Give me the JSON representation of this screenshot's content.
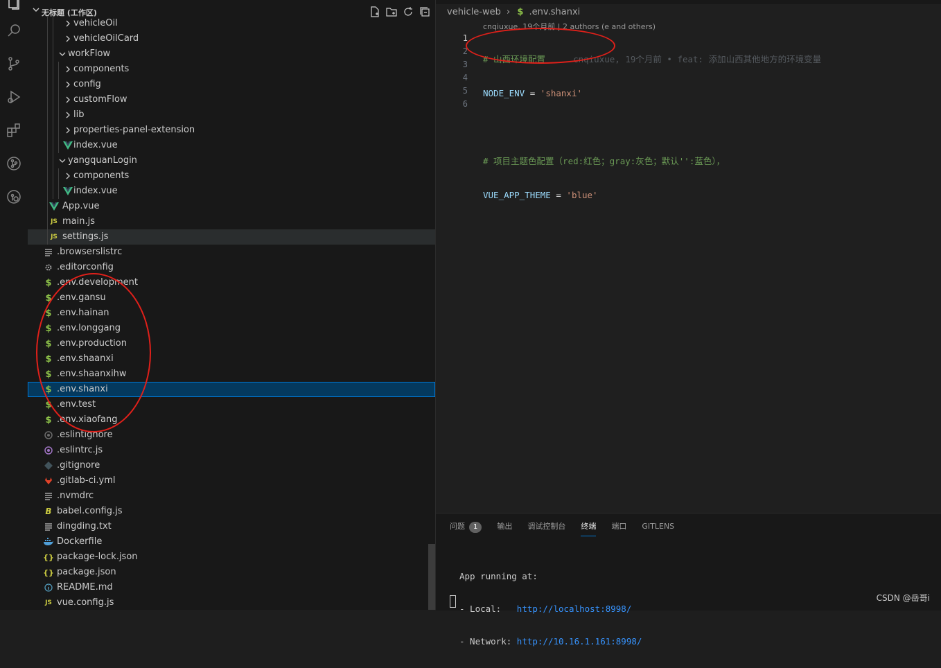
{
  "sidebar": {
    "title": "无标题 (工作区)",
    "items": [
      {
        "label": "vehicleOil",
        "type": "folder",
        "depth": 2,
        "icon": "chevron-right-icon"
      },
      {
        "label": "vehicleOilCard",
        "type": "folder",
        "depth": 2,
        "icon": "chevron-right-icon"
      },
      {
        "label": "workFlow",
        "type": "folder-open",
        "depth": 1,
        "icon": "chevron-down-icon"
      },
      {
        "label": "components",
        "type": "folder",
        "depth": 2,
        "icon": "chevron-right-icon"
      },
      {
        "label": "config",
        "type": "folder",
        "depth": 2,
        "icon": "chevron-right-icon"
      },
      {
        "label": "customFlow",
        "type": "folder",
        "depth": 2,
        "icon": "chevron-right-icon"
      },
      {
        "label": "lib",
        "type": "folder",
        "depth": 2,
        "icon": "chevron-right-icon"
      },
      {
        "label": "properties-panel-extension",
        "type": "folder",
        "depth": 2,
        "icon": "chevron-right-icon"
      },
      {
        "label": "index.vue",
        "type": "vue",
        "depth": 2,
        "icon": "vue-icon"
      },
      {
        "label": "yangquanLogin",
        "type": "folder-open",
        "depth": 1,
        "icon": "chevron-down-icon"
      },
      {
        "label": "components",
        "type": "folder",
        "depth": 2,
        "icon": "chevron-right-icon"
      },
      {
        "label": "index.vue",
        "type": "vue",
        "depth": 2,
        "icon": "vue-icon"
      },
      {
        "label": "App.vue",
        "type": "vue",
        "depth": 0,
        "icon": "vue-icon"
      },
      {
        "label": "main.js",
        "type": "js",
        "depth": 0,
        "icon": "js-icon"
      },
      {
        "label": "settings.js",
        "type": "js",
        "depth": 0,
        "icon": "js-icon",
        "hover": true
      },
      {
        "label": ".browserslistrc",
        "type": "lines",
        "depth": -1,
        "icon": "lines-icon"
      },
      {
        "label": ".editorconfig",
        "type": "gear",
        "depth": -1,
        "icon": "gear-icon"
      },
      {
        "label": ".env.development",
        "type": "env",
        "depth": -1,
        "icon": "dollar-icon"
      },
      {
        "label": ".env.gansu",
        "type": "env",
        "depth": -1,
        "icon": "dollar-icon"
      },
      {
        "label": ".env.hainan",
        "type": "env",
        "depth": -1,
        "icon": "dollar-icon"
      },
      {
        "label": ".env.longgang",
        "type": "env",
        "depth": -1,
        "icon": "dollar-icon"
      },
      {
        "label": ".env.production",
        "type": "env",
        "depth": -1,
        "icon": "dollar-icon"
      },
      {
        "label": ".env.shaanxi",
        "type": "env",
        "depth": -1,
        "icon": "dollar-icon"
      },
      {
        "label": ".env.shaanxihw",
        "type": "env",
        "depth": -1,
        "icon": "dollar-icon"
      },
      {
        "label": ".env.shanxi",
        "type": "env",
        "depth": -1,
        "icon": "dollar-icon",
        "selected": true
      },
      {
        "label": ".env.test",
        "type": "env",
        "depth": -1,
        "icon": "dollar-icon"
      },
      {
        "label": ".env.xiaofang",
        "type": "env",
        "depth": -1,
        "icon": "dollar-icon"
      },
      {
        "label": ".eslintignore",
        "type": "eslint-ignore",
        "depth": -1,
        "icon": "eslint-ignore-icon"
      },
      {
        "label": ".eslintrc.js",
        "type": "eslint",
        "depth": -1,
        "icon": "eslint-icon"
      },
      {
        "label": ".gitignore",
        "type": "git",
        "depth": -1,
        "icon": "git-icon"
      },
      {
        "label": ".gitlab-ci.yml",
        "type": "gitlab",
        "depth": -1,
        "icon": "gitlab-icon"
      },
      {
        "label": ".nvmdrc",
        "type": "lines",
        "depth": -1,
        "icon": "lines-icon"
      },
      {
        "label": "babel.config.js",
        "type": "babel",
        "depth": -1,
        "icon": "babel-icon"
      },
      {
        "label": "dingding.txt",
        "type": "lines",
        "depth": -1,
        "icon": "lines-icon"
      },
      {
        "label": "Dockerfile",
        "type": "docker",
        "depth": -1,
        "icon": "docker-icon"
      },
      {
        "label": "package-lock.json",
        "type": "json",
        "depth": -1,
        "icon": "json-icon"
      },
      {
        "label": "package.json",
        "type": "json",
        "depth": -1,
        "icon": "json-icon"
      },
      {
        "label": "README.md",
        "type": "info",
        "depth": -1,
        "icon": "info-icon"
      },
      {
        "label": "vue.config.js",
        "type": "js",
        "depth": -1,
        "icon": "js-icon"
      }
    ]
  },
  "editor": {
    "breadcrumb": {
      "root": "vehicle-web",
      "file": ".env.shanxi"
    },
    "codelens": "cnqiuxue, 19个月前 | 2 authors (e and others)",
    "line_numbers": [
      "1",
      "2",
      "3",
      "4",
      "5",
      "6"
    ],
    "lines": {
      "l1": "# 山西环境配置",
      "l1_blame": "cnqiuxue, 19个月前 • feat: 添加山西其他地方的环境变量",
      "l2_var": "NODE_ENV",
      "l2_op": " = ",
      "l2_str": "'shanxi'",
      "l4": "# 项目主题色配置（red:红色；gray:灰色；默认'':蓝色），",
      "l5_var": "VUE_APP_THEME",
      "l5_op": " = ",
      "l5_str": "'blue'"
    }
  },
  "panel": {
    "tabs": {
      "problems": "问题",
      "problems_count": "1",
      "output": "输出",
      "debug": "调试控制台",
      "terminal": "终端",
      "ports": "端口",
      "gitlens": "GITLENS"
    },
    "terminal": {
      "l1": "App running at:",
      "l2_prefix": "- Local:   ",
      "l2_link": "http://localhost:8998/",
      "l3_prefix": "- Network: ",
      "l3_link": "http://10.16.1.161:8998/"
    }
  },
  "watermark": "CSDN @岳哥i",
  "colors": {
    "accent": "#0078d4",
    "annotation": "#e0201a",
    "env_icon": "#8dc149",
    "vue_icon": "#41b883",
    "js_icon": "#cbcb41"
  }
}
